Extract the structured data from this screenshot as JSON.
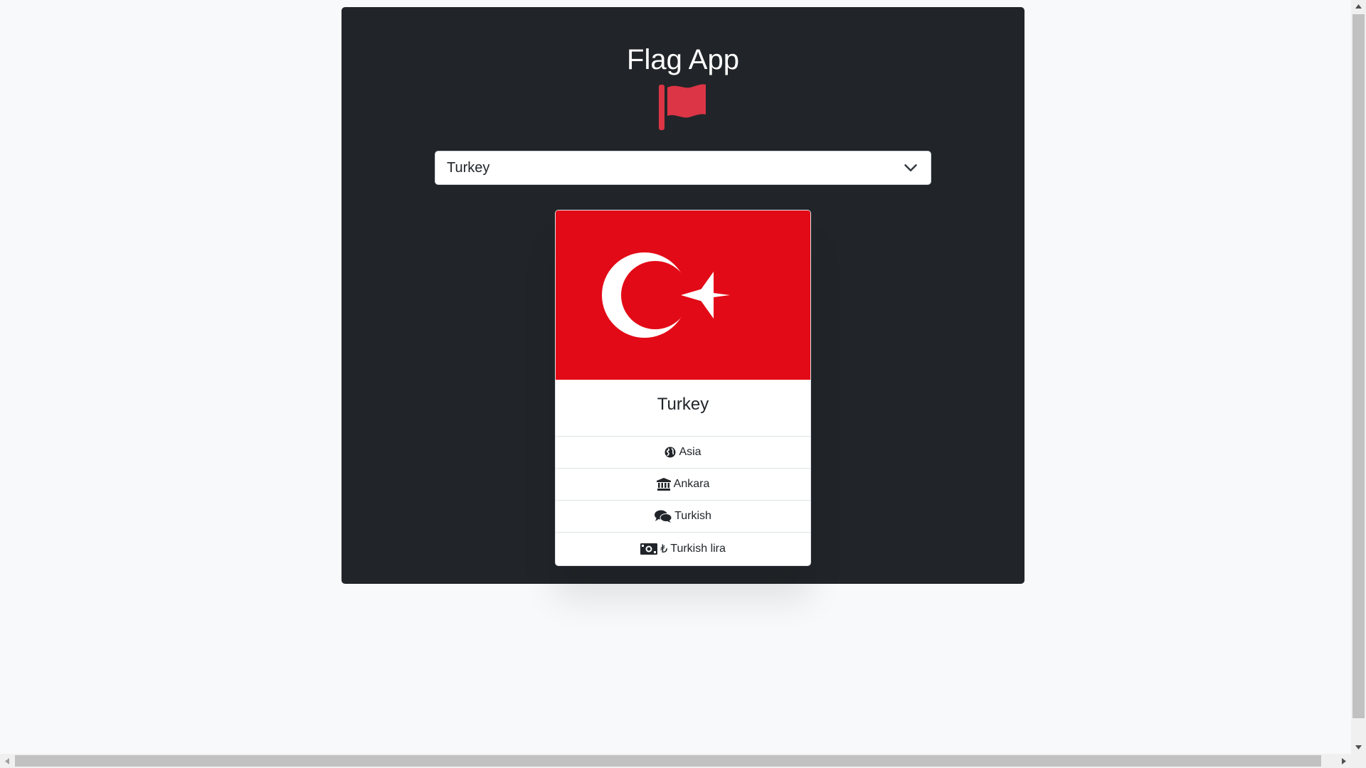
{
  "app": {
    "title": "Flag App",
    "logo_icon": "flag-icon",
    "logo_color": "#dc3545",
    "panel_color": "#212529",
    "background_color": "#f8f9fa"
  },
  "selector": {
    "selected": "Turkey",
    "icon": "chevron-down-icon"
  },
  "card": {
    "flag_icon": "turkey-flag",
    "flag_colors": {
      "red": "#e30a17",
      "white": "#ffffff"
    },
    "country_name": "Turkey",
    "details": [
      {
        "icon": "globe-icon",
        "text": "Asia"
      },
      {
        "icon": "landmark-icon",
        "text": "Ankara"
      },
      {
        "icon": "comments-icon",
        "text": "Turkish"
      },
      {
        "icon": "money-bill-icon",
        "symbol": "₺",
        "text": "Turkish lira"
      }
    ]
  }
}
